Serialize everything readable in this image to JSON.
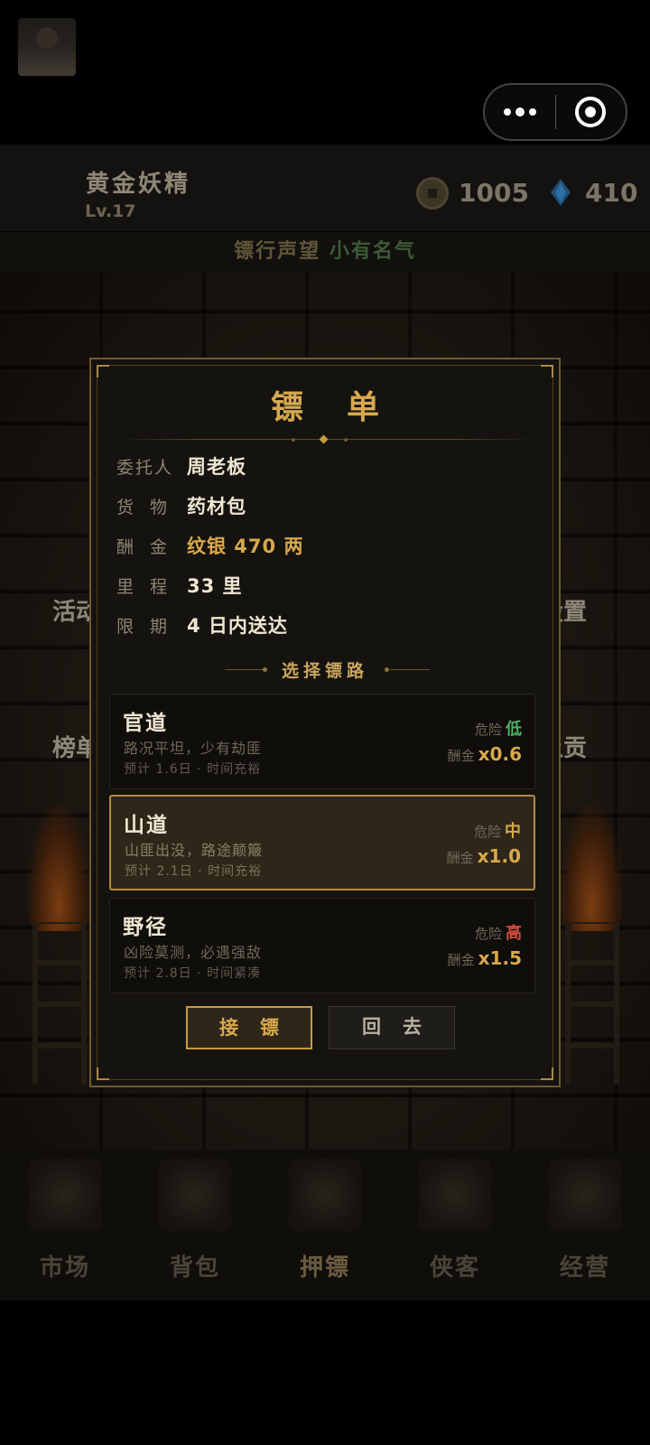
{
  "topbar": {
    "more_icon": "more-dots-icon",
    "close_icon": "target-close-icon"
  },
  "player": {
    "name": "黄金妖精",
    "level": "Lv.17",
    "coins": "1005",
    "gems": "410",
    "coin_icon": "copper-coin-icon",
    "gem_icon": "blue-gem-icon"
  },
  "reputation": {
    "label": "镖行声望",
    "value": "小有名气"
  },
  "side_labels": {
    "left_top": "活动",
    "left_bottom": "榜单",
    "right_top": "设置",
    "right_bottom": "上贡"
  },
  "modal": {
    "title": "镖单",
    "fields": [
      {
        "label": "委托人",
        "value": "周老板"
      },
      {
        "label": "货物",
        "value": "药材包"
      },
      {
        "label": "酬金",
        "value": "纹银 470 两"
      },
      {
        "label": "里程",
        "value": "33 里"
      },
      {
        "label": "限期",
        "value": "4 日内送达"
      }
    ],
    "route_header": "选择镖路",
    "risk_label": "危险",
    "pay_label": "酬金",
    "routes": [
      {
        "name": "官道",
        "desc": "路况平坦，少有劫匪",
        "eta": "预计 1.6日 · 时间充裕",
        "risk": "低",
        "risk_color": "#4caf63",
        "multiplier": "x0.6",
        "selected": false
      },
      {
        "name": "山道",
        "desc": "山匪出没，路途颠簸",
        "eta": "预计 2.1日 · 时间充裕",
        "risk": "中",
        "risk_color": "#d9a84c",
        "multiplier": "x1.0",
        "selected": true
      },
      {
        "name": "野径",
        "desc": "凶险莫测，必遇强敌",
        "eta": "预计 2.8日 · 时间紧凑",
        "risk": "高",
        "risk_color": "#d14a3c",
        "multiplier": "x1.5",
        "selected": false
      }
    ],
    "accept_label": "接镖",
    "back_label": "回去"
  },
  "nav": [
    {
      "label": "市场",
      "icon": "market-icon"
    },
    {
      "label": "背包",
      "icon": "backpack-icon"
    },
    {
      "label": "押镖",
      "icon": "escort-flag-icon",
      "active": true
    },
    {
      "label": "侠客",
      "icon": "hero-icon"
    },
    {
      "label": "经营",
      "icon": "business-icon"
    }
  ]
}
